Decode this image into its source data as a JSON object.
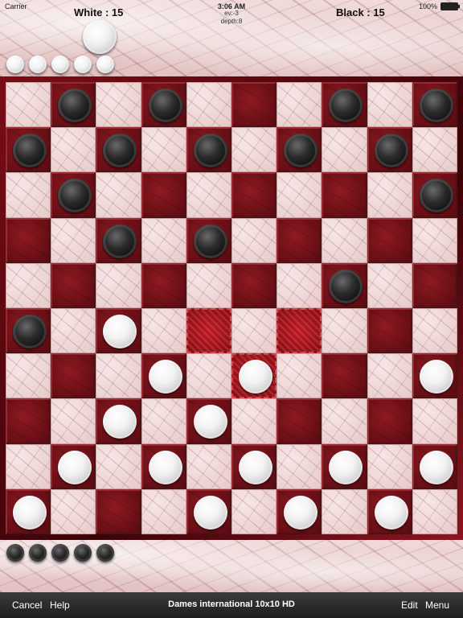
{
  "status_bar": {
    "carrier": "Carrier",
    "time": "3:06 AM",
    "battery": "100%"
  },
  "header": {
    "white_score": "White : 15",
    "black_score": "Black  : 15",
    "engine_info_line1": "ev:-3",
    "engine_info_line2": "depth:8"
  },
  "captured": {
    "white_count": 5,
    "black_count": 5
  },
  "board": {
    "size": 10,
    "rows": [
      ".b.b...b.b",
      "b.b.b.b.b.",
      ".b.......b",
      "..b.b.....",
      ".......b..",
      "b.w.......",
      "...w.w...w",
      "..w.w.....",
      ".w.w.w.w.w",
      "w...w.w.w."
    ],
    "highlighted_squares": [
      [
        5,
        4
      ],
      [
        5,
        6
      ],
      [
        6,
        5
      ]
    ],
    "white_color": "#f4f4f4",
    "black_color": "#1a1a1a",
    "dark_square_color": "#7a0f17",
    "light_square_color": "#f2dede"
  },
  "toolbar": {
    "cancel_label": "Cancel",
    "help_label": "Help",
    "title": "Dames international 10x10 HD",
    "edit_label": "Edit",
    "menu_label": "Menu"
  }
}
